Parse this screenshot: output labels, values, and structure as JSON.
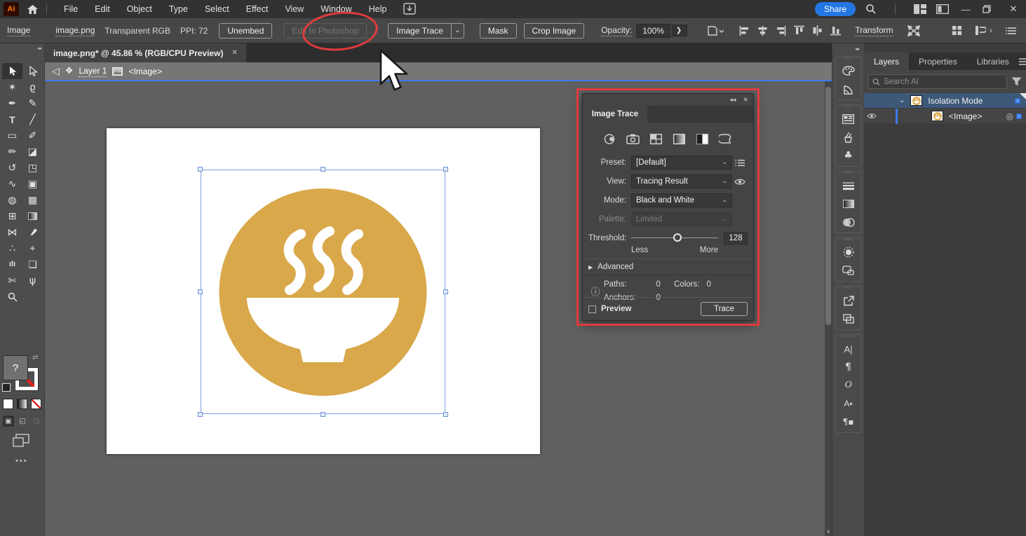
{
  "colors": {
    "gold": "#D9A84A",
    "annotation_red": "#E23B3C",
    "accent_blue": "#2377E4",
    "selection_blue": "#7FA3E2",
    "layer_highlight": "#3D5878"
  },
  "titlebar": {
    "logo": "Ai",
    "menus": [
      "File",
      "Edit",
      "Object",
      "Type",
      "Select",
      "Effect",
      "View",
      "Window",
      "Help"
    ],
    "share": "Share",
    "minimize": "—",
    "close": "✕"
  },
  "control_bar": {
    "context": "Image",
    "filename": "image.png",
    "color_mode": "Transparent RGB",
    "ppi": "PPI: 72",
    "unembed": "Unembed",
    "edit_in_photoshop": "Edit In Photoshop",
    "image_trace": "Image Trace",
    "image_trace_chevron": "⌄",
    "mask": "Mask",
    "crop_image": "Crop Image",
    "opacity_label": "Opacity:",
    "opacity_value": "100%",
    "opacity_arrow": "❯",
    "transform": "Transform"
  },
  "doc": {
    "tab_title": "image.png* @ 45.86 % (RGB/CPU Preview)",
    "tab_close": "✕",
    "back": "◁",
    "layers_glyph": "❖",
    "layer": "Layer 1",
    "object": "<Image>"
  },
  "toolbar": {
    "collapse": "◂◂",
    "fill_unknown": "?",
    "swap": "⇄",
    "more": "•••",
    "tool_glyphs": {
      "magic_wand": "✶",
      "lasso": "ϱ",
      "pen": "✒",
      "curvature": "✎",
      "type": "T",
      "line": "╱",
      "rectangle": "▭",
      "paintbrush": "✐",
      "shaper": "✏",
      "eraser": "◪",
      "rotate": "↺",
      "scale": "◳",
      "width": "∿",
      "free_transform": "▣",
      "shape_builder": "◍",
      "perspective_grid": "▦",
      "mesh": "⊞",
      "blend": "⋈",
      "symbolism": "∴",
      "symbol_sprayer": "⌖",
      "graph": "ılı",
      "artboard": "❏",
      "slice": "✄",
      "hand": "ψ"
    },
    "draw_normal": "▣",
    "draw_behind": "◱",
    "draw_inside": "◳"
  },
  "trace_panel": {
    "collapse": "◂◂",
    "close": "✕",
    "title": "Image Trace",
    "preset_label": "Preset:",
    "preset_value": "[Default]",
    "view_label": "View:",
    "view_value": "Tracing Result",
    "mode_label": "Mode:",
    "mode_value": "Black and White",
    "palette_label": "Palette:",
    "palette_value": "Limited",
    "chevron": "⌄",
    "threshold_label": "Threshold:",
    "threshold_value": "128",
    "less": "Less",
    "more": "More",
    "advanced_arrow": "▶",
    "advanced": "Advanced",
    "info": "ⓘ",
    "paths_label": "Paths:",
    "paths_value": "0",
    "anchors_label": "Anchors:",
    "anchors_value": "0",
    "colors_label": "Colors:",
    "colors_value": "0",
    "preview": "Preview",
    "trace": "Trace"
  },
  "dock": {
    "collapse": "◂◂",
    "symbols": "♣",
    "character": "A|",
    "paragraph": "¶",
    "opentype": "O",
    "character_styles": "A▪",
    "paragraph_styles": "¶▪"
  },
  "panels": {
    "tabs": [
      "Layers",
      "Properties",
      "Libraries"
    ],
    "search_placeholder": "Search AI",
    "rows": [
      {
        "chevron": "⌄",
        "label": "Isolation Mode"
      },
      {
        "target": "◎",
        "label": "<Image>"
      }
    ]
  },
  "scrollbar": {
    "down_arrow": "∨"
  }
}
